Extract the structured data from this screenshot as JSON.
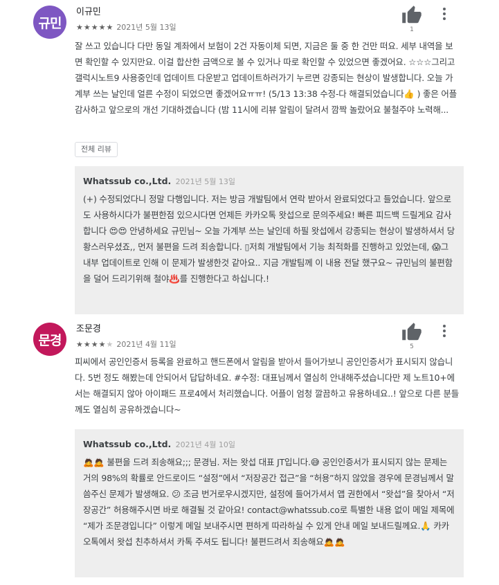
{
  "reviews": [
    {
      "avatar_text": "규민",
      "avatar_color": "#7e57c2",
      "author": "이규민",
      "rating": 5,
      "date": "2021년 5월 13일",
      "helpful_count": "1",
      "body": "잘 쓰고 있습니다 다만 동일 계좌에서 보험이 2건 자동이체 되면, 지금은 둘 중 한 건만 떠요. 세부 내역을 보면 확인할 수 있지만요. 이걸 합산한 금액으로 볼 수 있거나 따로 확인할 수 있었으면 좋겠어요. ☆☆☆그리고 갤럭시노트9 사용중인데 업데이트 다운받고 업데이트하러가기 누르면 강종되는 현상이 발생합니다. 오늘 가계부 쓰는 날인데 얼른 수정이 되었으면 좋겠어요ㅠㅠ! (5/13 13:38 수정-다 해결되었습니다👍 ) 좋은 어플 감사하고 앞으로의 개선 기대하겠습니다 (밤 11시에 리뷰 알림이 달려서 깜짝 놀랐어요 불철주야 노력해...",
      "full_review_label": "전체 리뷰",
      "reply": {
        "developer": "Whatssub co.,Ltd.",
        "date": "2021년 5월 13일",
        "text": "(+) 수정되었다니 정말 다행입니다. 저는 방금 개발팀에서 연락 받아서 완료되었다고 들었습니다. 앞으로도 사용하시다가 불편한점 있으시다면 언제든 카카오톡 왓섭으로 문의주세요! 빠른 피드백 드릴게요 감사합니다 😍😍 안녕하세요 규민님~ 오늘 가계부 쓰는 날인데 하필 왓섭에서 강종되는 현상이 발생하셔서 당황스러우셨죠,, 먼저 불편을 드려 죄송합니다. ▯저희 개발팀에서 기능 최적화를 진행하고 있었는데, 😱그 내부 업데이트로 인해 이 문제가 발생한것 같아요.. 지금 개발팀께 이 내용 전달 했구요~ 규민님의 불편함을 덜어 드리기위해 철야♨️를 진행한다고 하십니다.!"
      }
    },
    {
      "avatar_text": "문경",
      "avatar_color": "#c2185b",
      "author": "조문경",
      "rating": 4,
      "date": "2021년 4월 11일",
      "helpful_count": "5",
      "body": "피씨에서 공인인증서 등록을 완료하고 핸드폰에서 알림을 받아서 들어가보니 공인인증서가 표시되지 않습니다. 5번 정도 해봤는데 안되어서 답답하네요. #수정: 대표님께서 열심히 안내해주셨습니다만 제 노트10+에서는 해결되지 않아 아이패드 프로4에서 처리했습니다. 어플이 엄청 깔끔하고 유용하네요..! 앞으로 다른 분들께도 열심히 공유하겠습니다~",
      "reply": {
        "developer": "Whatssub co.,Ltd.",
        "date": "2021년 4월 10일",
        "text": "🙇🙇 불편을 드려 죄송해요;;; 문경님. 저는 왓섭 대표 JT입니다.😅 공인인증서가 표시되지 않는 문제는 거의 98%의 확률로 안드로이드 “설정”에서 “저장공간 접근”을 “허용”하지 않았을 경우에 문경님께서 말씀주신 문제가 발생해요. 😕 조금 번거로우시겠지만, 설정에 들어가셔서 앱 권한에서 “왓섭”을 찾아서 “저장공간” 허용해주시면 바로 해결될 것 같아요! contact@whatssub.co로 특별한 내용 없이 메일 제목에 “제가 조문경입니다” 이렇게 메일 보내주시면 편하게 따라하실 수 있게 안내 메일 보내드릴께요.🙏 카카오톡에서 왓섭 친추하셔서 카톡 주셔도 됩니다! 불편드려서 죄송해요🙇🙇"
      }
    }
  ],
  "colors": {
    "reply_bg": "#eeeeee",
    "star_on": "#616161",
    "star_off": "#c4c4c4"
  },
  "icons": {
    "helpful": "thumb-up-icon",
    "more": "more-vert-icon"
  }
}
